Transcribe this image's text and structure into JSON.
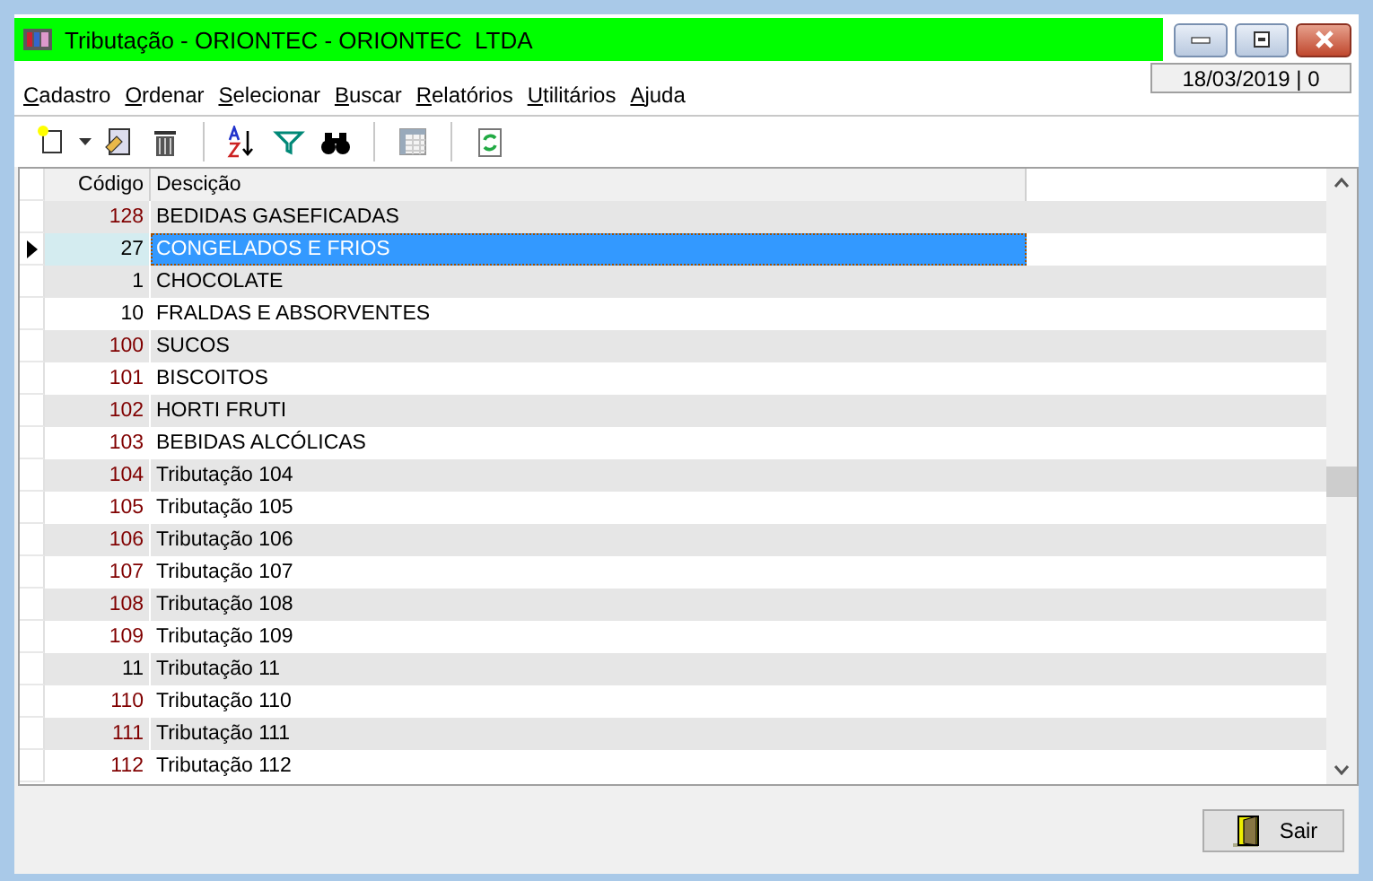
{
  "window": {
    "title": "Tributação - ORIONTEC - ORIONTEC  LTDA"
  },
  "date_box": "18/03/2019 | 0",
  "menu": [
    "Cadastro",
    "Ordenar",
    "Selecionar",
    "Buscar",
    "Relatórios",
    "Utilitários",
    "Ajuda"
  ],
  "table": {
    "columns": [
      "Código",
      "Descição"
    ],
    "rows": [
      {
        "code": "128",
        "description": "BEDIDAS GASEFICADAS",
        "selected": false,
        "color": "#800000"
      },
      {
        "code": "27",
        "description": "CONGELADOS E FRIOS",
        "selected": true,
        "color": "#000000"
      },
      {
        "code": "1",
        "description": "CHOCOLATE",
        "selected": false,
        "color": "#000000"
      },
      {
        "code": "10",
        "description": "FRALDAS E ABSORVENTES",
        "selected": false,
        "color": "#000000"
      },
      {
        "code": "100",
        "description": "SUCOS",
        "selected": false,
        "color": "#800000"
      },
      {
        "code": "101",
        "description": "BISCOITOS",
        "selected": false,
        "color": "#800000"
      },
      {
        "code": "102",
        "description": "HORTI FRUTI",
        "selected": false,
        "color": "#800000"
      },
      {
        "code": "103",
        "description": "BEBIDAS ALCÓLICAS",
        "selected": false,
        "color": "#800000"
      },
      {
        "code": "104",
        "description": "Tributação 104",
        "selected": false,
        "color": "#800000"
      },
      {
        "code": "105",
        "description": "Tributação 105",
        "selected": false,
        "color": "#800000"
      },
      {
        "code": "106",
        "description": "Tributação 106",
        "selected": false,
        "color": "#800000"
      },
      {
        "code": "107",
        "description": "Tributação 107",
        "selected": false,
        "color": "#800000"
      },
      {
        "code": "108",
        "description": "Tributação 108",
        "selected": false,
        "color": "#800000"
      },
      {
        "code": "109",
        "description": "Tributação 109",
        "selected": false,
        "color": "#800000"
      },
      {
        "code": "11",
        "description": "Tributação 11",
        "selected": false,
        "color": "#000000"
      },
      {
        "code": "110",
        "description": "Tributação 110",
        "selected": false,
        "color": "#800000"
      },
      {
        "code": "111",
        "description": "Tributação 111",
        "selected": false,
        "color": "#800000"
      },
      {
        "code": "112",
        "description": "Tributação 112",
        "selected": false,
        "color": "#800000"
      }
    ]
  },
  "buttons": [
    {
      "label": "Sair"
    }
  ]
}
